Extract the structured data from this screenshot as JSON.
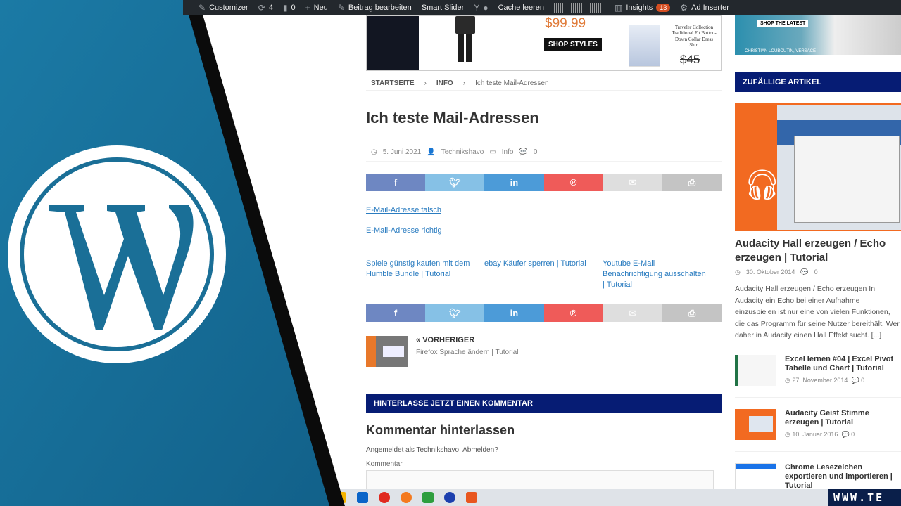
{
  "adminbar": {
    "customizer": "Customizer",
    "updates": "4",
    "comments": "0",
    "new": "Neu",
    "edit": "Beitrag bearbeiten",
    "smart_slider": "Smart Slider",
    "cache": "Cache leeren",
    "insights": "Insights",
    "insights_count": "13",
    "ad_inserter": "Ad Inserter"
  },
  "ad": {
    "price": "$99.99",
    "button": "SHOP STYLES",
    "shirt_text": "Traveler Collection Traditional Fit Button-Down Collar Dress Shirt",
    "old_price": "$45"
  },
  "breadcrumb": {
    "home": "STARTSEITE",
    "cat": "INFO",
    "current": "Ich teste Mail-Adressen",
    "sep": "›"
  },
  "post": {
    "title": "Ich teste Mail-Adressen",
    "date": "5. Juni 2021",
    "author": "Technikshavo",
    "category": "Info",
    "comments": "0",
    "link_wrong": "E-Mail-Adresse falsch",
    "link_right": "E-Mail-Adresse richtig"
  },
  "related": [
    "Spiele günstig kaufen mit dem Humble Bundle | Tutorial",
    "ebay Käufer sperren | Tutorial",
    "Youtube E-Mail Benachrichtigung ausschalten | Tutorial"
  ],
  "prev": {
    "label": "VORHERIGER",
    "title": "Firefox Sprache ändern | Tutorial"
  },
  "comment": {
    "bar": "HINTERLASSE JETZT EINEN KOMMENTAR",
    "title": "Kommentar hinterlassen",
    "logged": "Angemeldet als Technikshavo. Abmelden?",
    "label": "Kommentar"
  },
  "sidebar": {
    "shop_latest": "SHOP THE LATEST",
    "brands": "CHRISTIAN LOUBOUTIN, VERSACE",
    "heading": "ZUFÄLLIGE ARTIKEL",
    "featured_title": "Audacity Hall erzeugen / Echo erzeugen | Tutorial",
    "featured_date": "30. Oktober 2014",
    "featured_comments": "0",
    "featured_excerpt": "Audacity Hall erzeugen / Echo erzeugen In Audacity ein Echo bei einer Aufnahme einzuspielen ist nur eine von vielen Funktionen, die das Programm für seine Nutzer bereithält. Wer daher in Audacity einen Hall Effekt sucht. [...]",
    "items": [
      {
        "title": "Excel lernen #04 | Excel Pivot Tabelle und Chart | Tutorial",
        "date": "27. November 2014",
        "comments": "0"
      },
      {
        "title": "Audacity Geist Stimme erzeugen | Tutorial",
        "date": "10. Januar 2016",
        "comments": "0"
      },
      {
        "title": "Chrome Lesezeichen exportieren und importieren | Tutorial",
        "date": "",
        "comments": ""
      }
    ]
  },
  "taskbar": {
    "brand": "WWW.TE"
  },
  "colors": {
    "blue_banner": "#1a6f97",
    "nav_dark": "#061c74",
    "link": "#2a7cc0"
  }
}
